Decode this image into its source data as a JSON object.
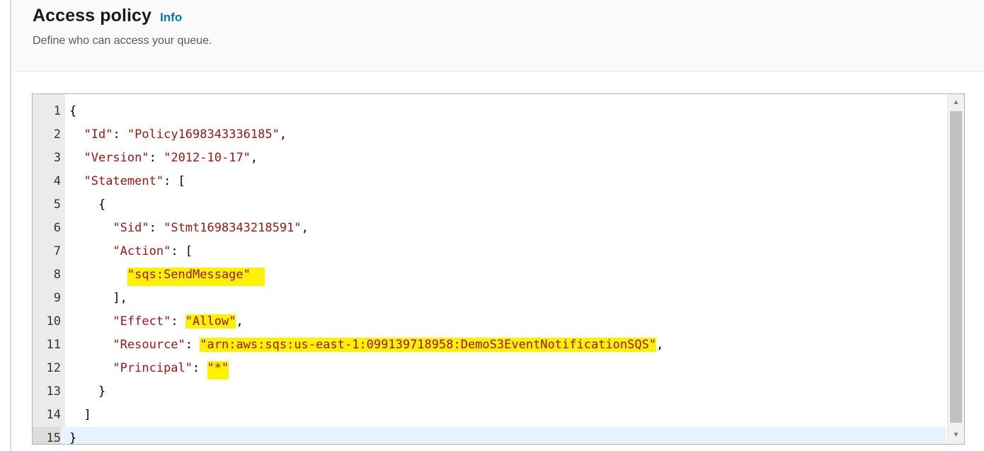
{
  "header": {
    "title": "Access policy",
    "info_label": "Info",
    "description": "Define who can access your queue."
  },
  "editor": {
    "lines": [
      {
        "n": "1",
        "parts": [
          {
            "t": "{",
            "c": "punc"
          }
        ]
      },
      {
        "n": "2",
        "parts": [
          {
            "t": "  ",
            "c": "punc"
          },
          {
            "t": "\"Id\"",
            "c": "key"
          },
          {
            "t": ": ",
            "c": "punc"
          },
          {
            "t": "\"Policy1698343336185\"",
            "c": "str"
          },
          {
            "t": ",",
            "c": "punc"
          }
        ]
      },
      {
        "n": "3",
        "parts": [
          {
            "t": "  ",
            "c": "punc"
          },
          {
            "t": "\"Version\"",
            "c": "key"
          },
          {
            "t": ": ",
            "c": "punc"
          },
          {
            "t": "\"2012-10-17\"",
            "c": "str"
          },
          {
            "t": ",",
            "c": "punc"
          }
        ]
      },
      {
        "n": "4",
        "parts": [
          {
            "t": "  ",
            "c": "punc"
          },
          {
            "t": "\"Statement\"",
            "c": "key"
          },
          {
            "t": ": [",
            "c": "punc"
          }
        ]
      },
      {
        "n": "5",
        "parts": [
          {
            "t": "    {",
            "c": "punc"
          }
        ]
      },
      {
        "n": "6",
        "parts": [
          {
            "t": "      ",
            "c": "punc"
          },
          {
            "t": "\"Sid\"",
            "c": "key"
          },
          {
            "t": ": ",
            "c": "punc"
          },
          {
            "t": "\"Stmt1698343218591\"",
            "c": "str"
          },
          {
            "t": ",",
            "c": "punc"
          }
        ]
      },
      {
        "n": "7",
        "parts": [
          {
            "t": "      ",
            "c": "punc"
          },
          {
            "t": "\"Action\"",
            "c": "key"
          },
          {
            "t": ": [",
            "c": "punc"
          }
        ]
      },
      {
        "n": "8",
        "parts": [
          {
            "t": "        ",
            "c": "punc"
          },
          {
            "t": "\"sqs:SendMessage\"  ",
            "c": "str hl-tall"
          }
        ]
      },
      {
        "n": "9",
        "parts": [
          {
            "t": "      ],",
            "c": "punc"
          }
        ]
      },
      {
        "n": "10",
        "parts": [
          {
            "t": "      ",
            "c": "punc"
          },
          {
            "t": "\"Effect\"",
            "c": "key"
          },
          {
            "t": ": ",
            "c": "punc"
          },
          {
            "t": "\"Allow\"",
            "c": "str hl"
          },
          {
            "t": ",",
            "c": "punc"
          }
        ]
      },
      {
        "n": "11",
        "parts": [
          {
            "t": "      ",
            "c": "punc"
          },
          {
            "t": "\"Resource\"",
            "c": "key"
          },
          {
            "t": ": ",
            "c": "punc"
          },
          {
            "t": "\"arn:aws:sqs:us-east-1:099139718958:DemoS3EventNotificationSQS\"",
            "c": "str hl"
          },
          {
            "t": ",",
            "c": "punc"
          }
        ]
      },
      {
        "n": "12",
        "parts": [
          {
            "t": "      ",
            "c": "punc"
          },
          {
            "t": "\"Principal\"",
            "c": "key"
          },
          {
            "t": ": ",
            "c": "punc"
          },
          {
            "t": "\"*\"",
            "c": "str hl-tall"
          }
        ]
      },
      {
        "n": "13",
        "parts": [
          {
            "t": "    }",
            "c": "punc"
          }
        ]
      },
      {
        "n": "14",
        "parts": [
          {
            "t": "  ]",
            "c": "punc"
          }
        ]
      },
      {
        "n": "15",
        "parts": [
          {
            "t": "}",
            "c": "punc"
          }
        ],
        "active": true
      }
    ]
  },
  "colors": {
    "accent": "#0073bb",
    "string": "#a31515",
    "highlight": "#fff200",
    "active_line": "#e8f2fe"
  },
  "icons": {
    "scroll_up": "chevron-up-icon",
    "scroll_down": "chevron-down-icon"
  }
}
